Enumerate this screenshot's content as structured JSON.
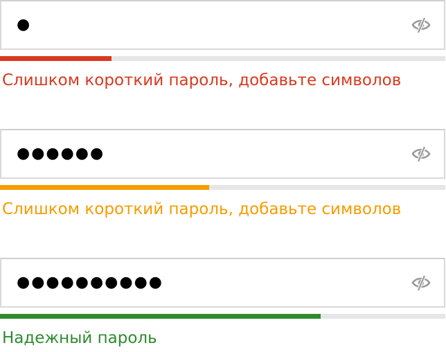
{
  "fields": [
    {
      "masked_value": "●",
      "strength": 0.25,
      "color": "#d9391f",
      "message": "Слишком короткий пароль, добавьте символов",
      "icon": "eye-slash-icon"
    },
    {
      "masked_value": "●●●●●●",
      "strength": 0.47,
      "color": "#f59c00",
      "message": "Слишком короткий пароль, добавьте символов",
      "icon": "eye-slash-icon"
    },
    {
      "masked_value": "●●●●●●●●●●",
      "strength": 0.72,
      "color": "#2e8b2e",
      "message": "Надежный пароль",
      "icon": "eye-slash-icon"
    }
  ],
  "colors": {
    "field_border": "#d9d9d9",
    "track": "#e6e6e6",
    "icon": "#9a9a9a"
  }
}
